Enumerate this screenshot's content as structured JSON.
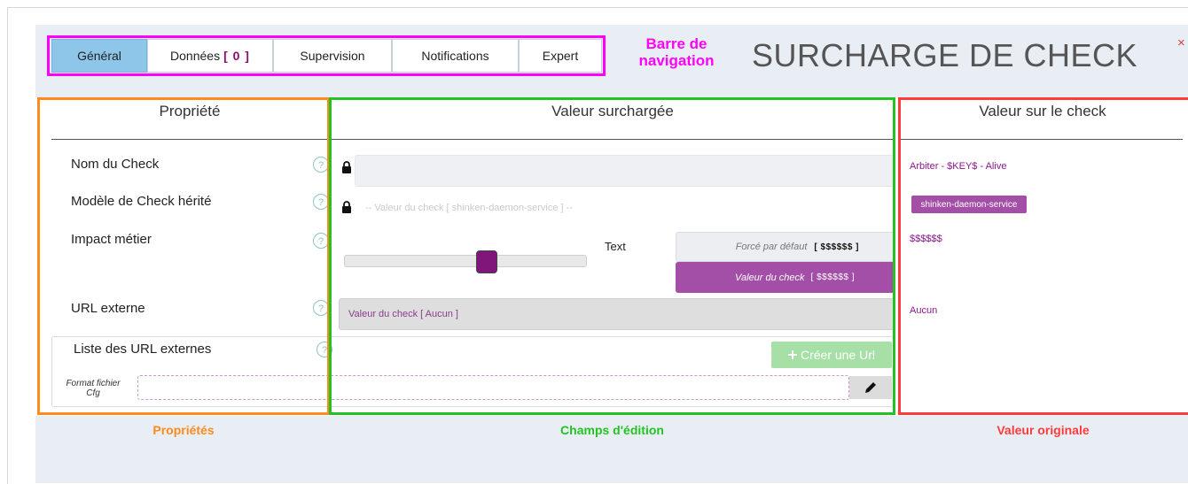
{
  "tabs": [
    {
      "label": "Général",
      "active": true
    },
    {
      "label": "Données",
      "count": "[ 0 ]",
      "active": false
    },
    {
      "label": "Supervision",
      "active": false
    },
    {
      "label": "Notifications",
      "active": false
    },
    {
      "label": "Expert",
      "active": false
    }
  ],
  "annotations": {
    "nav_bar_line1": "Barre de",
    "nav_bar_line2": "navigation",
    "properties": "Propriétés",
    "edit_fields": "Champs d'édition",
    "original_value": "Valeur originale"
  },
  "title": "SURCHARGE DE CHECK",
  "close_label": "×",
  "columns": {
    "property": "Propriété",
    "override": "Valeur surchargée",
    "check_value": "Valeur sur le check"
  },
  "properties": [
    {
      "label": "Nom du Check"
    },
    {
      "label": "Modèle de Check hérité"
    },
    {
      "label": "Impact métier"
    },
    {
      "label": "URL externe"
    },
    {
      "label": "Liste des URL externes"
    }
  ],
  "help_glyph": "?",
  "override": {
    "inherited_placeholder": "-- Valeur du check [ shinken-daemon-service ] --",
    "slider_text": "Text",
    "forced_label": "Forcé par défaut",
    "forced_code": "[ $$$$$$ ]",
    "check_label": "Valeur du check",
    "check_code": "[ $$$$$$ ]",
    "url_value": "Valeur du check [ Aucun ]",
    "create_url": "Créer une Url",
    "format_label_1": "Format fichier",
    "format_label_2": "Cfg"
  },
  "original": {
    "check_name": "Arbiter - $KEY$ - Alive",
    "template": "shinken-daemon-service",
    "impact": "$$$$$$",
    "url": "Aucun"
  },
  "colors": {
    "nav_annotation": "#ff00ff",
    "properties_outline": "#ff8a1e",
    "edit_outline": "#22c322",
    "original_outline": "#ff3a3a",
    "accent_purple": "#a34ea7",
    "active_tab": "#8ec6ea"
  },
  "icons": [
    "lock-icon",
    "help-icon",
    "plus-icon",
    "pencil-icon",
    "close-icon"
  ]
}
